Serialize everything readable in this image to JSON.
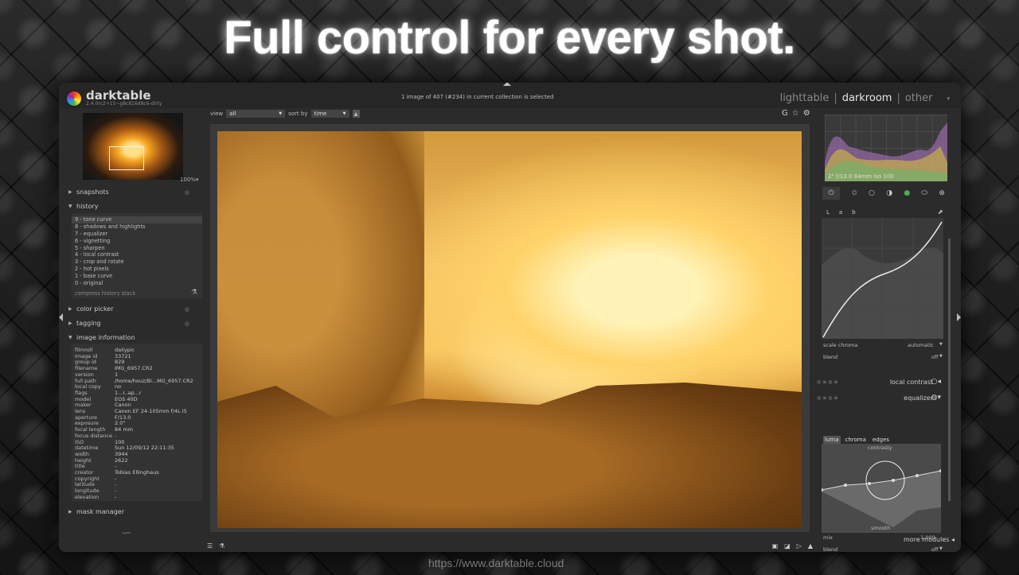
{
  "headline": "Full control for every shot.",
  "app": {
    "name": "darktable",
    "version": "2.4.0rc2+15~g8c816d8c6-dirty"
  },
  "status_text": "1 image of 407 (#234) in current collection is selected",
  "views": {
    "lighttable": "lighttable",
    "darkroom": "darkroom",
    "other": "other",
    "sep": "|"
  },
  "left_panel": {
    "zoom": "100%▾",
    "snapshots": "snapshots",
    "history_title": "history",
    "history_items": [
      "9 - tone curve",
      "8 - shadows and highlights",
      "7 - equalizer",
      "6 - vignetting",
      "5 - sharpen",
      "4 - local contrast",
      "3 - crop and rotate",
      "2 - hot pixels",
      "1 - base curve",
      "0 - original"
    ],
    "compress": "compress history stack",
    "color_picker": "color picker",
    "tagging": "tagging",
    "image_information": "image information",
    "info": [
      {
        "k": "filmroll",
        "v": "dailypic"
      },
      {
        "k": "image id",
        "v": "33721"
      },
      {
        "k": "group id",
        "v": "829"
      },
      {
        "k": "filename",
        "v": "IMG_6957.CR2"
      },
      {
        "k": "version",
        "v": "1"
      },
      {
        "k": "full path",
        "v": "/home/houz/Bi...MG_6957.CR2"
      },
      {
        "k": "local copy",
        "v": "no"
      },
      {
        "k": "flags",
        "v": "1...r..ap...r"
      },
      {
        "k": "model",
        "v": "EOS 40D"
      },
      {
        "k": "maker",
        "v": "Canon"
      },
      {
        "k": "lens",
        "v": "Canon EF 24-105mm f/4L IS"
      },
      {
        "k": "aperture",
        "v": "F/13.0"
      },
      {
        "k": "exposure",
        "v": "2.0\""
      },
      {
        "k": "focal length",
        "v": "84 mm"
      },
      {
        "k": "focus distance",
        "v": "-"
      },
      {
        "k": "ISO",
        "v": "100"
      },
      {
        "k": "datetime",
        "v": "Sun 12/09/12 22:11:35"
      },
      {
        "k": "width",
        "v": "3944"
      },
      {
        "k": "height",
        "v": "2622"
      },
      {
        "k": "title",
        "v": "-"
      },
      {
        "k": "creator",
        "v": "Tobias Ellinghaus"
      },
      {
        "k": "copyright",
        "v": "-"
      },
      {
        "k": "latitude",
        "v": "-"
      },
      {
        "k": "longitude",
        "v": "-"
      },
      {
        "k": "elevation",
        "v": "-"
      }
    ],
    "mask_manager": "mask manager"
  },
  "viewbar": {
    "view_label": "view",
    "view_value": "all",
    "sort_label": "sort by",
    "sort_value": "time",
    "sort_dir": "▲"
  },
  "right_panel": {
    "histogram_label": "2\" f/13.0 84mm iso 100",
    "tc_tabs": [
      "L",
      "a",
      "b"
    ],
    "scale_chroma": "scale chroma",
    "scale_chroma_value": "automatic",
    "blend": "blend",
    "blend_value": "off",
    "local_contrast": "local contrast",
    "equalizer": "equalizer",
    "eq_tabs": [
      "luma",
      "chroma",
      "edges"
    ],
    "eq_top_label": "contrasty",
    "eq_bottom_label": "smooth",
    "mix": "mix",
    "mix_value": "1.000",
    "blend2": "blend",
    "blend2_value": "off",
    "more_modules": "more modules"
  },
  "watermark": "https://www.darktable.cloud",
  "colors": {
    "accent_green": "#4caf50",
    "photo_warm": "#f4c063"
  }
}
